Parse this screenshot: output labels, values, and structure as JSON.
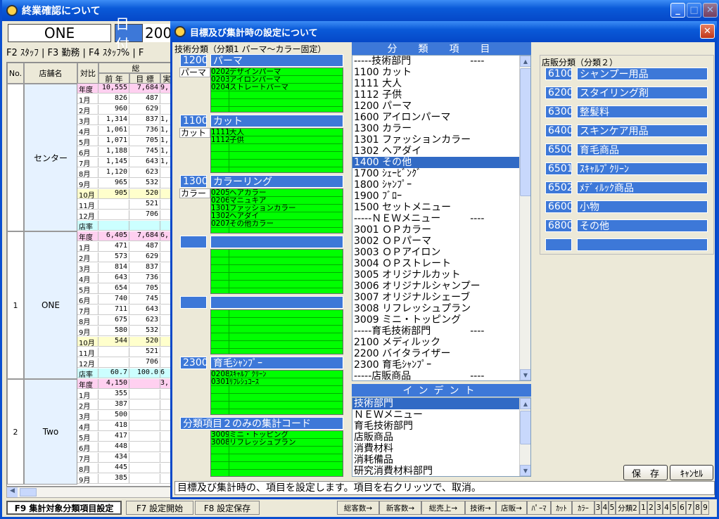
{
  "main_window": {
    "title": "終業確認について",
    "store_box": "ONE",
    "date_label": "日付",
    "date_value": "200",
    "menu": "F2 ｽﾀｯﾌ | F3 勤務 | F4 ｽﾀｯﾌ% | F",
    "grid_headers": {
      "no": "No.",
      "store": "店舗名",
      "compare": "対比",
      "sou": "総",
      "prev": "前 年",
      "target": "目 標",
      "actual": "実"
    },
    "groups": [
      {
        "no": "",
        "name": "センター",
        "rows": [
          {
            "label": "年度",
            "prev": "10,555",
            "target": "7,684",
            "actual": "9,",
            "color": "#ffd0f0"
          },
          {
            "label": "1月",
            "prev": "826",
            "target": "487",
            "actual": "",
            "color": "#fff"
          },
          {
            "label": "2月",
            "prev": "960",
            "target": "629",
            "actual": "",
            "color": "#fff"
          },
          {
            "label": "3月",
            "prev": "1,314",
            "target": "837",
            "actual": "1,",
            "color": "#fff"
          },
          {
            "label": "4月",
            "prev": "1,061",
            "target": "736",
            "actual": "1,",
            "color": "#fff"
          },
          {
            "label": "5月",
            "prev": "1,071",
            "target": "705",
            "actual": "1,",
            "color": "#fff"
          },
          {
            "label": "6月",
            "prev": "1,188",
            "target": "745",
            "actual": "1,",
            "color": "#fff"
          },
          {
            "label": "7月",
            "prev": "1,145",
            "target": "643",
            "actual": "1,",
            "color": "#fff"
          },
          {
            "label": "8月",
            "prev": "1,120",
            "target": "623",
            "actual": "",
            "color": "#fff"
          },
          {
            "label": "9月",
            "prev": "965",
            "target": "532",
            "actual": "",
            "color": "#fff"
          },
          {
            "label": "10月",
            "prev": "905",
            "target": "520",
            "actual": "",
            "color": "#ffffcc"
          },
          {
            "label": "11月",
            "prev": "",
            "target": "521",
            "actual": "",
            "color": "#fff"
          },
          {
            "label": "12月",
            "prev": "",
            "target": "706",
            "actual": "",
            "color": "#fff"
          },
          {
            "label": "店率",
            "prev": "",
            "target": "",
            "actual": "",
            "color": "#ccffff"
          }
        ]
      },
      {
        "no": "1",
        "name": "ONE",
        "rows": [
          {
            "label": "年度",
            "prev": "6,405",
            "target": "7,684",
            "actual": "6,",
            "color": "#ffd0f0"
          },
          {
            "label": "1月",
            "prev": "471",
            "target": "487",
            "actual": "",
            "color": "#fff"
          },
          {
            "label": "2月",
            "prev": "573",
            "target": "629",
            "actual": "",
            "color": "#fff"
          },
          {
            "label": "3月",
            "prev": "814",
            "target": "837",
            "actual": "",
            "color": "#fff"
          },
          {
            "label": "4月",
            "prev": "643",
            "target": "736",
            "actual": "",
            "color": "#fff"
          },
          {
            "label": "5月",
            "prev": "654",
            "target": "705",
            "actual": "",
            "color": "#fff"
          },
          {
            "label": "6月",
            "prev": "740",
            "target": "745",
            "actual": "",
            "color": "#fff"
          },
          {
            "label": "7月",
            "prev": "711",
            "target": "643",
            "actual": "",
            "color": "#fff"
          },
          {
            "label": "8月",
            "prev": "675",
            "target": "623",
            "actual": "",
            "color": "#fff"
          },
          {
            "label": "9月",
            "prev": "580",
            "target": "532",
            "actual": "",
            "color": "#fff"
          },
          {
            "label": "10月",
            "prev": "544",
            "target": "520",
            "actual": "",
            "color": "#ffffcc"
          },
          {
            "label": "11月",
            "prev": "",
            "target": "521",
            "actual": "",
            "color": "#fff"
          },
          {
            "label": "12月",
            "prev": "",
            "target": "706",
            "actual": "",
            "color": "#fff"
          },
          {
            "label": "店率",
            "prev": "60.7",
            "target": "100.0",
            "actual": "6",
            "color": "#ccffff"
          }
        ]
      },
      {
        "no": "2",
        "name": "Two",
        "rows": [
          {
            "label": "年度",
            "prev": "4,150",
            "target": "",
            "actual": "3,",
            "color": "#ffd0f0"
          },
          {
            "label": "1月",
            "prev": "355",
            "target": "",
            "actual": "",
            "color": "#fff"
          },
          {
            "label": "2月",
            "prev": "387",
            "target": "",
            "actual": "",
            "color": "#fff"
          },
          {
            "label": "3月",
            "prev": "500",
            "target": "",
            "actual": "",
            "color": "#fff"
          },
          {
            "label": "4月",
            "prev": "418",
            "target": "",
            "actual": "",
            "color": "#fff"
          },
          {
            "label": "5月",
            "prev": "417",
            "target": "",
            "actual": "",
            "color": "#fff"
          },
          {
            "label": "6月",
            "prev": "448",
            "target": "",
            "actual": "",
            "color": "#fff"
          },
          {
            "label": "7月",
            "prev": "434",
            "target": "",
            "actual": "",
            "color": "#fff"
          },
          {
            "label": "8月",
            "prev": "445",
            "target": "",
            "actual": "",
            "color": "#fff"
          },
          {
            "label": "9月",
            "prev": "385",
            "target": "",
            "actual": "",
            "color": "#fff"
          }
        ]
      }
    ],
    "fkeys": [
      "F9 集計対象分類項目設定",
      "F7 設定開始",
      "F8 設定保存"
    ],
    "right_buttons": [
      "総客数→",
      "新客数→",
      "総売上→",
      "技術→",
      "店販→",
      "ﾊﾟｰﾏ",
      "ｶｯﾄ",
      "ｶﾗｰ",
      "3",
      "4",
      "5",
      "分類2",
      "1",
      "2",
      "3",
      "4",
      "5",
      "6",
      "7",
      "8",
      "9"
    ]
  },
  "dialog": {
    "title": "目標及び集計時の設定について",
    "tech_header": "技術分類（分類1 パーマ～カラー固定）",
    "tech_groups": [
      {
        "code": "1200",
        "name": "パーマ",
        "label": "パーマ",
        "items": [
          [
            "0202",
            "デザインパーマ"
          ],
          [
            "0203",
            "アイロンパーマ"
          ],
          [
            "0204",
            "ストレートパーマ"
          ],
          [
            "",
            ""
          ],
          [
            "",
            ""
          ],
          [
            "",
            ""
          ]
        ]
      },
      {
        "code": "1100",
        "name": "カット",
        "label": "カット",
        "items": [
          [
            "1111",
            "大人"
          ],
          [
            "1112",
            "子供"
          ],
          [
            "",
            ""
          ],
          [
            "",
            ""
          ],
          [
            "",
            ""
          ],
          [
            "",
            ""
          ]
        ]
      },
      {
        "code": "1300",
        "name": "カラーリング",
        "label": "カラー",
        "items": [
          [
            "0205",
            "ヘアカラー"
          ],
          [
            "0206",
            "マニュキア"
          ],
          [
            "1301",
            "ファッションカラー"
          ],
          [
            "1302",
            "ヘアダイ"
          ],
          [
            "0207",
            "その他カラー"
          ],
          [
            "",
            ""
          ]
        ]
      },
      {
        "code": "",
        "name": "",
        "label": "",
        "items": [
          [
            "",
            ""
          ],
          [
            "",
            ""
          ],
          [
            "",
            ""
          ],
          [
            "",
            ""
          ],
          [
            "",
            ""
          ],
          [
            "",
            ""
          ]
        ]
      },
      {
        "code": "",
        "name": "",
        "label": "",
        "items": [
          [
            "",
            ""
          ],
          [
            "",
            ""
          ],
          [
            "",
            ""
          ],
          [
            "",
            ""
          ],
          [
            "",
            ""
          ],
          [
            "",
            ""
          ]
        ]
      },
      {
        "code": "2300",
        "name": "育毛ｼｬﾝﾌﾟｰ",
        "label": "",
        "items": [
          [
            "0208",
            "ｽｷｬﾙﾌﾟｸﾘｰﾝ"
          ],
          [
            "0301",
            "ﾘﾌﾚｼｭｺｰｽ"
          ],
          [
            "",
            ""
          ],
          [
            "",
            ""
          ],
          [
            "",
            ""
          ],
          [
            "",
            ""
          ]
        ]
      }
    ],
    "class2_only_header": "分類項目２のみの集計コード",
    "class2_only_items": [
      [
        "3009",
        "ミニ・トッピング"
      ],
      [
        "3008",
        "リフレッシュプラン"
      ],
      [
        "",
        ""
      ],
      [
        "",
        ""
      ],
      [
        "",
        ""
      ],
      [
        "",
        ""
      ]
    ],
    "bunrui_header": "分　類　項　目",
    "bunrui_items": [
      "-----技術部門　　　　　　----",
      "1100 カット",
      "1111 大人",
      "1112 子供",
      "1200 パーマ",
      "1600 アイロンパーマ",
      "1300 カラー",
      "1301 ファッションカラー",
      "1302 ヘアダイ",
      "1400 その他",
      "1700 ｼｪｰﾋﾞﾝｸﾞ",
      "1800 ｼｬﾝﾌﾟｰ",
      "1900 ﾌﾞﾛｰ",
      "1500 セットメニュー",
      "-----ＮＥＷメニュー　　　----",
      "3001 ＯＰカラー",
      "3002 ＯＰパーマ",
      "3003 ＯＰアイロン",
      "3004 ＯＰストレート",
      "3005 オリジナルカット",
      "3006 オリジナルシャンプー",
      "3007 オリジナルシェーブ",
      "3008 リフレッシュプラン",
      "3009 ミニ・トッピング",
      "-----育毛技術部門　　　　----",
      "2100 メディルック",
      "2200 バイタライザー",
      "2300 育毛ｼｬﾝﾌﾟｰ",
      "-----店販商品　　　　　　----"
    ],
    "bunrui_selected": 9,
    "indent_header": "インデント",
    "indent_items": [
      "技術部門",
      "ＮＥＷメニュー",
      "育毛技術部門",
      "店販商品",
      "消費材料",
      "消耗備品",
      "研究消費材料部門"
    ],
    "indent_selected": 0,
    "sales_header": "店販分類（分類２）",
    "sales_items": [
      [
        "6100",
        "シャンプー用品"
      ],
      [
        "6200",
        "スタイリング剤"
      ],
      [
        "6300",
        "整髪料"
      ],
      [
        "6400",
        "スキンケア用品"
      ],
      [
        "6500",
        "育毛商品"
      ],
      [
        "6501",
        "ｽｷｬﾙﾌﾟｸﾘｰﾝ"
      ],
      [
        "6502",
        "ﾒﾃﾞｨﾙｯｸ商品"
      ],
      [
        "6600",
        "小物"
      ],
      [
        "6800",
        "その他"
      ],
      [
        "",
        ""
      ]
    ],
    "save_button": "保　存",
    "cancel_button": "ｷｬﾝｾﾙ",
    "status_text": "目標及び集計時の、項目を設定します。項目を右クリッツで、取消。"
  }
}
